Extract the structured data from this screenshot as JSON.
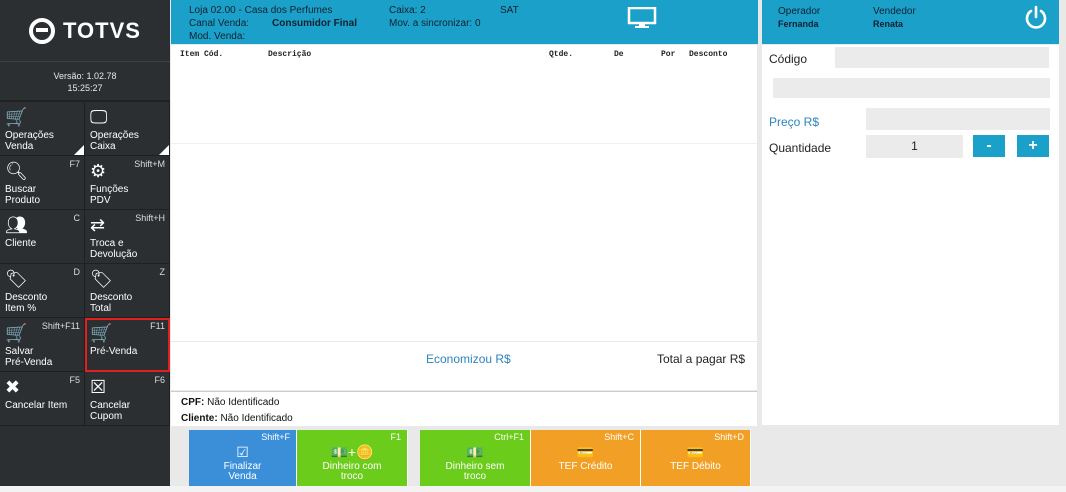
{
  "sidebar": {
    "brand": "TOTVS",
    "version": "Versão: 1.02.78",
    "time": "15:25:27",
    "tiles": [
      {
        "label": "Operações\nVenda",
        "key": "",
        "icon": "cart-icon",
        "glyph": "🛒"
      },
      {
        "label": "Operações\nCaixa",
        "key": "",
        "icon": "monitor-icon",
        "glyph": "🖵"
      },
      {
        "label": "Buscar\nProduto",
        "key": "F7",
        "icon": "search-icon",
        "glyph": "🔍︎"
      },
      {
        "label": "Funções\nPDV",
        "key": "Shift+M",
        "icon": "gear-icon",
        "glyph": "⚙"
      },
      {
        "label": "Cliente",
        "key": "C",
        "icon": "users-icon",
        "glyph": "👥︎"
      },
      {
        "label": "Troca e\nDevolução",
        "key": "Shift+H",
        "icon": "exchange-icon",
        "glyph": "⇄"
      },
      {
        "label": "Desconto\nItem %",
        "key": "D",
        "icon": "tag-icon",
        "glyph": "🏷︎"
      },
      {
        "label": "Desconto\nTotal",
        "key": "Z",
        "icon": "tags-icon",
        "glyph": "🏷︎"
      },
      {
        "label": "Salvar\nPré-Venda",
        "key": "Shift+F11",
        "icon": "cart-clock-icon",
        "glyph": "🛒"
      },
      {
        "label": "Pré-Venda",
        "key": "F11",
        "icon": "cart-clock-icon",
        "glyph": "🛒"
      },
      {
        "label": "Cancelar Item",
        "key": "F5",
        "icon": "close-circle-icon",
        "glyph": "✖"
      },
      {
        "label": "Cancelar\nCupom",
        "key": "F6",
        "icon": "close-box-icon",
        "glyph": "☒"
      }
    ]
  },
  "header": {
    "loja": "Loja 02.00 - Casa dos Perfumes",
    "canal_label": "Canal Venda:",
    "canal_value": "Consumidor Final",
    "mod_label": "Mod. Venda:",
    "caixa": "Caixa: 2",
    "mov": "Mov. a sincronizar: 0",
    "sat": "SAT"
  },
  "table": {
    "columns": [
      "Item Cód.",
      "Descrição",
      "Qtde.",
      "De",
      "Por",
      "Desconto"
    ]
  },
  "totals": {
    "economizou": "Economizou R$",
    "total": "Total a pagar R$"
  },
  "customer": {
    "cpf_label": "CPF:",
    "cpf_value": "Não Identificado",
    "cliente_label": "Cliente:",
    "cliente_value": "Não Identificado"
  },
  "actions": [
    {
      "label": "Finalizar\nVenda",
      "key": "Shift+F",
      "color": "#3b8fd9",
      "icon": "check-icon",
      "glyph": "☑"
    },
    {
      "label": "Dinheiro com\ntroco",
      "key": "F1",
      "color": "#6ccc1c",
      "icon": "cash-coins-icon",
      "glyph": "💵+🪙"
    },
    {
      "label": "Dinheiro sem\ntroco",
      "key": "Ctrl+F1",
      "color": "#6ccc1c",
      "icon": "cash-icon",
      "glyph": "💵"
    },
    {
      "label": "TEF Crédito",
      "key": "Shift+C",
      "color": "#f2a025",
      "icon": "credit-card-icon",
      "glyph": "💳"
    },
    {
      "label": "TEF Débito",
      "key": "Shift+D",
      "color": "#f2a025",
      "icon": "debit-card-icon",
      "glyph": "💳"
    }
  ],
  "right": {
    "operador_label": "Operador",
    "operador_value": "Fernanda",
    "vendedor_label": "Vendedor",
    "vendedor_value": "Renata",
    "codigo_label": "Código",
    "preco_label": "Preço R$",
    "quantidade_label": "Quantidade",
    "quantidade_value": "1",
    "minus": "-",
    "plus": "+"
  }
}
